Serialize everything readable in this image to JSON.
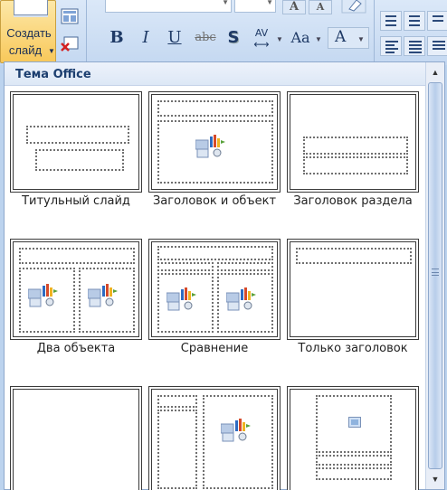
{
  "ribbon": {
    "new_slide_line1": "Создать",
    "new_slide_line2": "слайд",
    "buttons": {
      "bold": "B",
      "italic": "I",
      "underline": "U",
      "strikethrough": "abc",
      "shadow": "S",
      "spacing": "AV",
      "change_case": "Aa",
      "font_color": "A",
      "grow_font": "A",
      "shrink_font": "A"
    }
  },
  "gallery": {
    "title": "Тема Office",
    "layouts": [
      {
        "label": "Титульный слайд"
      },
      {
        "label": "Заголовок и объект"
      },
      {
        "label": "Заголовок раздела"
      },
      {
        "label": "Два объекта"
      },
      {
        "label": "Сравнение"
      },
      {
        "label": "Только заголовок"
      },
      {
        "label": ""
      },
      {
        "label": ""
      },
      {
        "label": ""
      }
    ]
  },
  "colors": {
    "accent": "#1d3f70",
    "ribbon_bg": "#c4d8f1",
    "button_active": "#f8c85a"
  }
}
